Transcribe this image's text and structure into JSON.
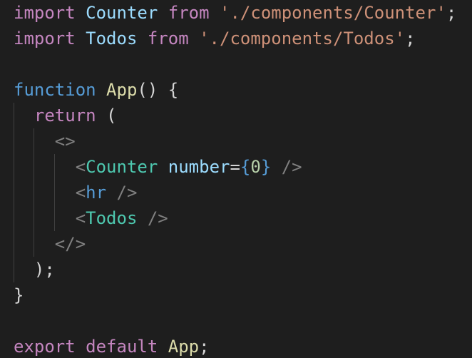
{
  "colors": {
    "background": "#1e1e1e",
    "keyword": "#c586c0",
    "storage": "#569cd6",
    "function": "#dcdcaa",
    "variable": "#9cdcfe",
    "string": "#ce9178",
    "punctuation": "#d4d4d4",
    "tag_bracket": "#808080",
    "component": "#4ec9b0",
    "number": "#b5cea8",
    "indent_guide": "#404040"
  },
  "lines": [
    [
      {
        "text": "import",
        "type": "keyword"
      },
      {
        "text": " ",
        "type": "punctuation"
      },
      {
        "text": "Counter",
        "type": "variable"
      },
      {
        "text": " ",
        "type": "punctuation"
      },
      {
        "text": "from",
        "type": "keyword"
      },
      {
        "text": " ",
        "type": "punctuation"
      },
      {
        "text": "'./components/Counter'",
        "type": "string"
      },
      {
        "text": ";",
        "type": "punctuation"
      }
    ],
    [
      {
        "text": "import",
        "type": "keyword"
      },
      {
        "text": " ",
        "type": "punctuation"
      },
      {
        "text": "Todos",
        "type": "variable"
      },
      {
        "text": " ",
        "type": "punctuation"
      },
      {
        "text": "from",
        "type": "keyword"
      },
      {
        "text": " ",
        "type": "punctuation"
      },
      {
        "text": "'./components/Todos'",
        "type": "string"
      },
      {
        "text": ";",
        "type": "punctuation"
      }
    ],
    [],
    [
      {
        "text": "function",
        "type": "storage"
      },
      {
        "text": " ",
        "type": "punctuation"
      },
      {
        "text": "App",
        "type": "function"
      },
      {
        "text": "() {",
        "type": "punctuation"
      }
    ],
    [
      {
        "text": "  ",
        "type": "punctuation"
      },
      {
        "text": "return",
        "type": "keyword"
      },
      {
        "text": " (",
        "type": "punctuation"
      }
    ],
    [
      {
        "text": "    ",
        "type": "punctuation"
      },
      {
        "text": "<>",
        "type": "tag_bracket"
      }
    ],
    [
      {
        "text": "      ",
        "type": "punctuation"
      },
      {
        "text": "<",
        "type": "tag_bracket"
      },
      {
        "text": "Counter",
        "type": "component"
      },
      {
        "text": " ",
        "type": "punctuation"
      },
      {
        "text": "number",
        "type": "variable"
      },
      {
        "text": "=",
        "type": "punctuation"
      },
      {
        "text": "{",
        "type": "storage"
      },
      {
        "text": "0",
        "type": "number"
      },
      {
        "text": "}",
        "type": "storage"
      },
      {
        "text": " ",
        "type": "punctuation"
      },
      {
        "text": "/>",
        "type": "tag_bracket"
      }
    ],
    [
      {
        "text": "      ",
        "type": "punctuation"
      },
      {
        "text": "<",
        "type": "tag_bracket"
      },
      {
        "text": "hr",
        "type": "storage"
      },
      {
        "text": " ",
        "type": "punctuation"
      },
      {
        "text": "/>",
        "type": "tag_bracket"
      }
    ],
    [
      {
        "text": "      ",
        "type": "punctuation"
      },
      {
        "text": "<",
        "type": "tag_bracket"
      },
      {
        "text": "Todos",
        "type": "component"
      },
      {
        "text": " ",
        "type": "punctuation"
      },
      {
        "text": "/>",
        "type": "tag_bracket"
      }
    ],
    [
      {
        "text": "    ",
        "type": "punctuation"
      },
      {
        "text": "</>",
        "type": "tag_bracket"
      }
    ],
    [
      {
        "text": "  ",
        "type": "punctuation"
      },
      {
        "text": ");",
        "type": "punctuation"
      }
    ],
    [
      {
        "text": "}",
        "type": "punctuation"
      }
    ],
    [],
    [
      {
        "text": "export",
        "type": "keyword"
      },
      {
        "text": " ",
        "type": "punctuation"
      },
      {
        "text": "default",
        "type": "keyword"
      },
      {
        "text": " ",
        "type": "punctuation"
      },
      {
        "text": "App",
        "type": "function"
      },
      {
        "text": ";",
        "type": "punctuation"
      }
    ]
  ]
}
